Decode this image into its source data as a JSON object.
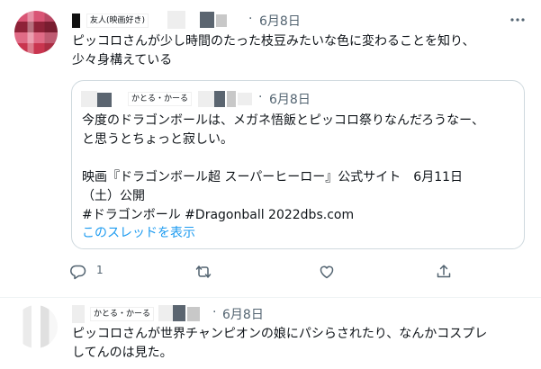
{
  "tweet1": {
    "display_name_image": "友人(映画好き)",
    "separator": "·",
    "date": "6月8日",
    "text": "ピッコロさんが少し時間のたった枝豆みたいな色に変わることを知り、\n少々身構えている",
    "quote": {
      "display_name_image": "かとる・かーる",
      "separator": "·",
      "date": "6月8日",
      "text": "今度のドラゴンボールは、メガネ悟飯とピッコロ祭りなんだろうなー、\nと思うとちょっと寂しい。\n\n映画『ドラゴンボール超 スーパーヒーロー』公式サイト　6月11日\n（土）公開\n#ドラゴンボール #Dragonball 2022dbs.com",
      "show_thread": "このスレッドを表示"
    },
    "actions": {
      "reply_count": "1",
      "icons": [
        "reply-icon",
        "retweet-icon",
        "like-icon",
        "share-icon"
      ]
    }
  },
  "tweet2": {
    "display_name_image": "かとる・かーる",
    "separator": "·",
    "date": "6月8日",
    "text": "ピッコロさんが世界チャンピオンの娘にパシらされたり、なんかコスプレ\nしてんのは見た。"
  },
  "colors": {
    "link_blue": "#1d9bf0",
    "secondary_text": "#536471",
    "border": "#cfd9de"
  }
}
